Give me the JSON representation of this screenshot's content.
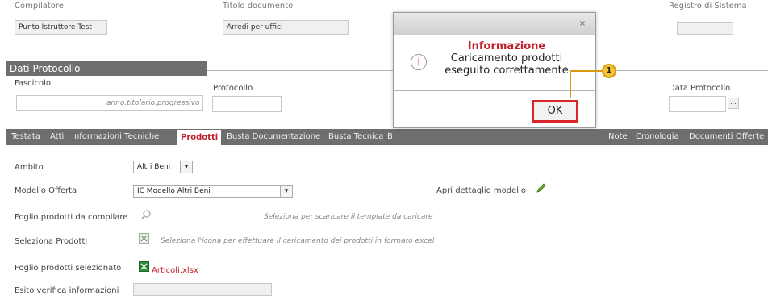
{
  "top_fields": {
    "compilatore_label": "Compilatore",
    "compilatore_value": "Punto Istruttore Test",
    "titolo_label": "Titolo documento",
    "titolo_value": "Arredi per uffici",
    "registro_label": "Registro di Sistema"
  },
  "dati_protocollo": {
    "header": "Dati Protocollo",
    "fascicolo_label": "Fascicolo",
    "fascicolo_hint": "anno.titolario.progressivo",
    "protocollo_label": "Protocollo",
    "data_protocollo_label": "Data Protocollo",
    "calendar_btn": "..."
  },
  "tabs": {
    "items": [
      "Testata",
      "Atti",
      "Informazioni Tecniche",
      "Prodotti",
      "Busta Documentazione",
      "Busta Tecnica",
      "B"
    ],
    "right_items": [
      "Note",
      "Cronologia",
      "Documenti",
      "Offerte"
    ]
  },
  "form": {
    "ambito_label": "Ambito",
    "ambito_value": "Altri Beni",
    "modello_label": "Modello Offerta",
    "modello_value": "IC Modello Altri Beni",
    "apri_label": "Apri dettaglio modello",
    "foglio_label": "Foglio prodotti da compilare",
    "foglio_hint": "Seleziona per scaricare il template da caricare",
    "seleziona_label": "Seleziona Prodotti",
    "seleziona_hint": "Seleziona l'icona per effettuare il caricamento dei prodotti in formato excel",
    "foglio_sel_label": "Foglio prodotti selezionato",
    "file_name": "Articoli.xlsx",
    "esito_label": "Esito verifica informazioni"
  },
  "modal": {
    "close": "×",
    "title": "Informazione",
    "message_line1": "Caricamento prodotti",
    "message_line2": "eseguito correttamente",
    "ok_label": "OK"
  },
  "callout": {
    "number": "1"
  },
  "colors": {
    "accent_red": "#c0202a",
    "tab_bar": "#6e6e6e",
    "callout": "#f7c531",
    "ok_border": "#d9262c"
  }
}
